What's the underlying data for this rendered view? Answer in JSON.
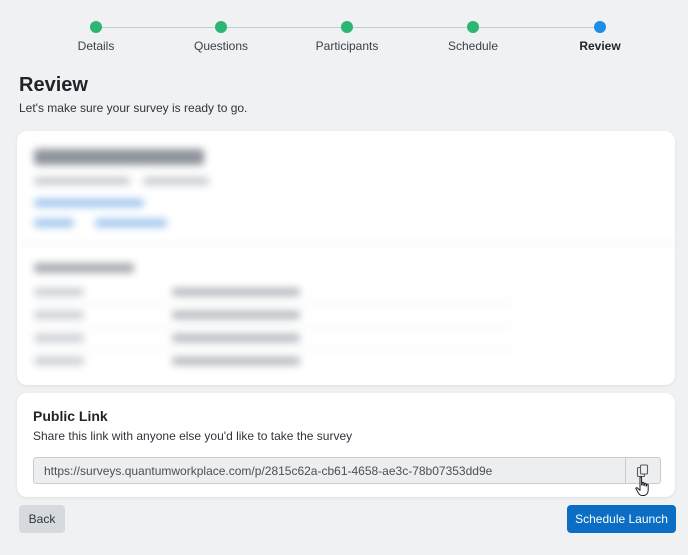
{
  "stepper": {
    "steps": [
      {
        "label": "Details",
        "state": "complete"
      },
      {
        "label": "Questions",
        "state": "complete"
      },
      {
        "label": "Participants",
        "state": "complete"
      },
      {
        "label": "Schedule",
        "state": "complete"
      },
      {
        "label": "Review",
        "state": "active"
      }
    ],
    "complete_color": "#2bb673",
    "active_color": "#1a8fe3"
  },
  "page": {
    "title": "Review",
    "subtitle": "Let's make sure your survey is ready to go."
  },
  "public_link": {
    "heading": "Public Link",
    "description": "Share this link with anyone else you'd like to take the survey",
    "url": "https://surveys.quantumworkplace.com/p/2815c62a-cb61-4658-ae3c-78b07353dd9e",
    "copy_icon": "copy-icon"
  },
  "footer": {
    "back_label": "Back",
    "launch_label": "Schedule Launch",
    "primary_color": "#0b6ec4"
  }
}
